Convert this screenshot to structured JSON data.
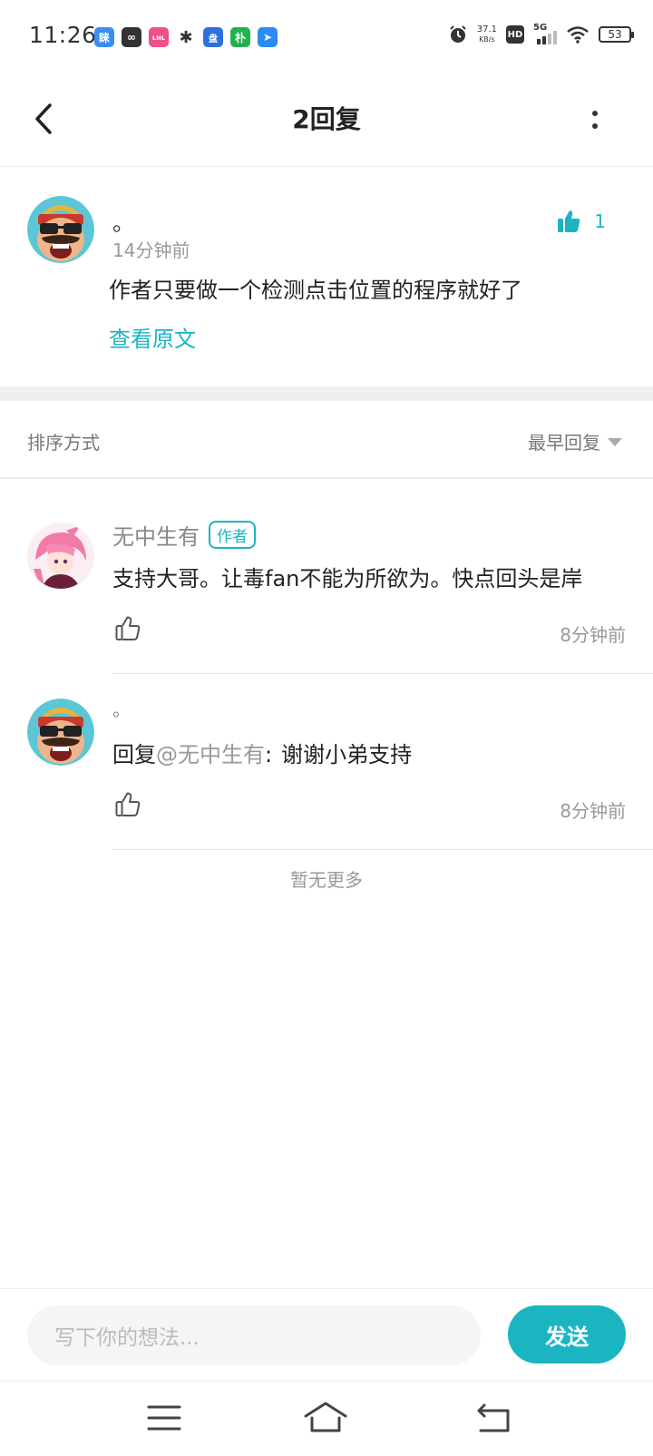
{
  "status_bar": {
    "time": "11:26",
    "net_speed_value": "37.1",
    "net_speed_unit": "KB/s",
    "hd_label": "HD",
    "network_label": "5G",
    "battery_level": "53",
    "app_icons": [
      {
        "name": "app-icon-1",
        "glyph": "睐",
        "color": "#3b8ef0"
      },
      {
        "name": "app-icon-2",
        "glyph": "♾",
        "color": "#333333"
      },
      {
        "name": "app-icon-3",
        "glyph": "ʟʜʟ",
        "color": "#f0508a"
      },
      {
        "name": "weibo-icon",
        "glyph": "✱",
        "color": "#333333"
      },
      {
        "name": "app-icon-5",
        "glyph": "盘",
        "color": "#2f6fe0"
      },
      {
        "name": "app-icon-6",
        "glyph": "朴",
        "color": "#22b24c"
      },
      {
        "name": "app-icon-7",
        "glyph": "➤",
        "color": "#2b8bf2"
      }
    ]
  },
  "nav": {
    "title": "2回复"
  },
  "original_comment": {
    "username": "。",
    "time": "14分钟前",
    "text": "作者只要做一个检测点击位置的程序就好了",
    "view_original": "查看原文",
    "like_count": "1"
  },
  "sort": {
    "label": "排序方式",
    "selected": "最早回复"
  },
  "replies": [
    {
      "username": "无中生有",
      "tag": "作者",
      "text": "支持大哥。让毒fan不能为所欲为。快点回头是岸",
      "time": "8分钟前"
    },
    {
      "username": "。",
      "reply_prefix": "回复",
      "mention": "@无中生有",
      "reply_colon": ":",
      "text": "谢谢小弟支持",
      "time": "8分钟前"
    }
  ],
  "no_more": "暂无更多",
  "input": {
    "placeholder": "写下你的想法...",
    "send_label": "发送"
  },
  "colors": {
    "accent": "#1bb5c2"
  }
}
